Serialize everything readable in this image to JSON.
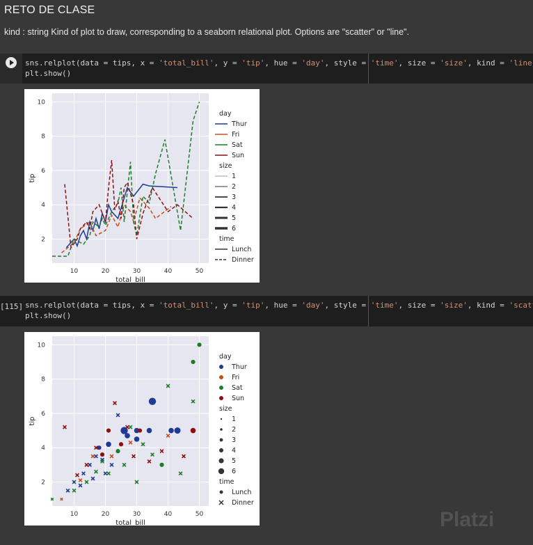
{
  "markdown": {
    "title": "RETO DE CLASE",
    "description": "kind : string Kind of plot to draw, corresponding to a seaborn relational plot. Options are \"scatter\" or \"line\"."
  },
  "cells": [
    {
      "exec_count": "",
      "code_line1_pre": "sns.relplot(data = tips, x = ",
      "code_line1_s1": "'total_bill'",
      "code_line1_m1": ", y = ",
      "code_line1_s2": "'tip'",
      "code_line1_m2": ", hue = ",
      "code_line1_s3": "'day'",
      "code_line1_m3": ", style = ",
      "code_line1_s4": "'time'",
      "code_line1_m4": ", size = ",
      "code_line1_s5": "'size'",
      "code_line1_m5": ", kind = ",
      "code_line1_s6": "'line'",
      "code_line1_end": ")",
      "code_line2": "plt.show()"
    },
    {
      "exec_count": "[115]",
      "code_line1_pre": "sns.relplot(data = tips, x = ",
      "code_line1_s1": "'total_bill'",
      "code_line1_m1": ", y = ",
      "code_line1_s2": "'tip'",
      "code_line1_m2": ", hue = ",
      "code_line1_s3": "'day'",
      "code_line1_m3": ", style = ",
      "code_line1_s4": "'time'",
      "code_line1_m4": ", size = ",
      "code_line1_s5": "'size'",
      "code_line1_m5": ", kind = ",
      "code_line1_s6": "'scatter'",
      "code_line1_end": ")",
      "code_line2": "plt.show()"
    }
  ],
  "watermark": "Platzi",
  "colors": {
    "Thur": "#1f3a93",
    "Fri": "#c0501a",
    "Sat": "#1f7a2a",
    "Sun": "#8b1010",
    "plot_bg": "#e6e6f0"
  },
  "chart_data": [
    {
      "type": "line",
      "xlabel": "total_bill",
      "ylabel": "tip",
      "xticks": [
        10,
        20,
        30,
        40,
        50
      ],
      "yticks": [
        2,
        4,
        6,
        8,
        10
      ],
      "xlim": [
        3,
        53
      ],
      "ylim": [
        0.6,
        10.5
      ],
      "legend": {
        "hue_title": "day",
        "hue": [
          "Thur",
          "Fri",
          "Sat",
          "Sun"
        ],
        "size_title": "size",
        "sizes": [
          "1",
          "2",
          "3",
          "4",
          "5",
          "6"
        ],
        "style_title": "time",
        "styles": [
          "Lunch",
          "Dinner"
        ]
      },
      "series": [
        {
          "name": "Thur",
          "style": "Lunch",
          "x": [
            7.5,
            10,
            11,
            12,
            13,
            14,
            15,
            16,
            17,
            18,
            19,
            20,
            21,
            22,
            24,
            27,
            29,
            32,
            34,
            43
          ],
          "y": [
            1.5,
            2,
            1.6,
            2.2,
            2.5,
            2,
            3,
            2.5,
            3.2,
            2.6,
            3.5,
            3,
            4,
            3.6,
            3.2,
            5,
            4.5,
            5.2,
            5.1,
            5.0
          ]
        },
        {
          "name": "Fri",
          "style": "Dinner",
          "x": [
            6,
            10,
            12,
            15,
            17,
            20,
            22,
            24,
            26,
            28,
            29,
            31,
            34,
            36,
            41
          ],
          "y": [
            1.2,
            1.8,
            2.6,
            3,
            2.2,
            2.5,
            3.4,
            2.7,
            4,
            3.6,
            3,
            4.4,
            3.8,
            3.2,
            3.9
          ]
        },
        {
          "name": "Sat",
          "style": "Dinner",
          "x": [
            3,
            8,
            10,
            13,
            15,
            16,
            18,
            19,
            20,
            22,
            24,
            25,
            26,
            28,
            29,
            30,
            32,
            34,
            36,
            39,
            44,
            48,
            50
          ],
          "y": [
            1,
            1,
            2,
            1.7,
            2.2,
            3,
            2.7,
            3.2,
            2.8,
            3.6,
            4.1,
            5,
            3,
            6.5,
            3,
            2.2,
            4.5,
            4.1,
            5.8,
            7.8,
            2.5,
            8.9,
            10
          ]
        },
        {
          "name": "Sun",
          "style": "Dinner",
          "x": [
            7,
            9,
            11,
            12,
            14,
            15,
            16,
            18,
            20,
            21,
            22,
            23,
            24,
            25,
            26,
            27,
            29,
            30,
            32,
            35,
            40,
            43,
            48
          ],
          "y": [
            5.2,
            1.5,
            2,
            2.6,
            3,
            2.6,
            3.6,
            4,
            3,
            5,
            6.6,
            3.7,
            4.2,
            3.2,
            5,
            5.3,
            4,
            2,
            3.5,
            5,
            3.6,
            4,
            3.2
          ]
        }
      ]
    },
    {
      "type": "scatter",
      "xlabel": "total_bill",
      "ylabel": "tip",
      "xticks": [
        10,
        20,
        30,
        40,
        50
      ],
      "yticks": [
        2,
        4,
        6,
        8,
        10
      ],
      "xlim": [
        3,
        53
      ],
      "ylim": [
        0.6,
        10.5
      ],
      "legend": {
        "hue_title": "day",
        "hue": [
          "Thur",
          "Fri",
          "Sat",
          "Sun"
        ],
        "size_title": "size",
        "sizes": [
          "1",
          "2",
          "3",
          "4",
          "5",
          "6"
        ],
        "style_title": "time",
        "styles": [
          "Lunch",
          "Dinner"
        ]
      },
      "points": [
        {
          "day": "Thur",
          "x": 8,
          "y": 1.5,
          "size": 2
        },
        {
          "day": "Thur",
          "x": 10,
          "y": 2,
          "size": 2
        },
        {
          "day": "Thur",
          "x": 12,
          "y": 1.8,
          "size": 2
        },
        {
          "day": "Thur",
          "x": 13,
          "y": 2.5,
          "size": 2
        },
        {
          "day": "Thur",
          "x": 15,
          "y": 3,
          "size": 2
        },
        {
          "day": "Thur",
          "x": 16,
          "y": 2.2,
          "size": 2
        },
        {
          "day": "Thur",
          "x": 17,
          "y": 3.5,
          "size": 2
        },
        {
          "day": "Thur",
          "x": 18,
          "y": 4,
          "size": 3
        },
        {
          "day": "Thur",
          "x": 19,
          "y": 3.3,
          "size": 2
        },
        {
          "day": "Thur",
          "x": 20,
          "y": 2.5,
          "size": 2
        },
        {
          "day": "Thur",
          "x": 21,
          "y": 4.2,
          "size": 4
        },
        {
          "day": "Thur",
          "x": 22,
          "y": 3,
          "size": 2
        },
        {
          "day": "Thur",
          "x": 24,
          "y": 5.9,
          "size": 2
        },
        {
          "day": "Thur",
          "x": 27,
          "y": 4.7,
          "size": 4
        },
        {
          "day": "Thur",
          "x": 30,
          "y": 4.5,
          "size": 4
        },
        {
          "day": "Thur",
          "x": 30,
          "y": 5,
          "size": 4
        },
        {
          "day": "Thur",
          "x": 35,
          "y": 6.7,
          "size": 6
        },
        {
          "day": "Thur",
          "x": 34,
          "y": 5,
          "size": 4
        },
        {
          "day": "Thur",
          "x": 41,
          "y": 5,
          "size": 4
        },
        {
          "day": "Thur",
          "x": 43,
          "y": 5,
          "size": 5
        },
        {
          "day": "Thur",
          "x": 26,
          "y": 5,
          "size": 6
        },
        {
          "day": "Fri",
          "x": 6,
          "y": 1,
          "size": 1
        },
        {
          "day": "Fri",
          "x": 12,
          "y": 2.1,
          "size": 2
        },
        {
          "day": "Fri",
          "x": 16,
          "y": 3.5,
          "size": 2
        },
        {
          "day": "Fri",
          "x": 22,
          "y": 3.5,
          "size": 2
        },
        {
          "day": "Fri",
          "x": 28,
          "y": 4.3,
          "size": 2
        },
        {
          "day": "Fri",
          "x": 40,
          "y": 4.7,
          "size": 2
        },
        {
          "day": "Sat",
          "x": 3,
          "y": 1,
          "size": 1
        },
        {
          "day": "Sat",
          "x": 10,
          "y": 1.5,
          "size": 2
        },
        {
          "day": "Sat",
          "x": 14,
          "y": 2,
          "size": 2
        },
        {
          "day": "Sat",
          "x": 17,
          "y": 2.6,
          "size": 2
        },
        {
          "day": "Sat",
          "x": 19,
          "y": 3.2,
          "size": 2
        },
        {
          "day": "Sat",
          "x": 21,
          "y": 2.5,
          "size": 2
        },
        {
          "day": "Sat",
          "x": 24,
          "y": 3.8,
          "size": 3
        },
        {
          "day": "Sat",
          "x": 26,
          "y": 3,
          "size": 2
        },
        {
          "day": "Sat",
          "x": 28,
          "y": 5.2,
          "size": 2
        },
        {
          "day": "Sat",
          "x": 30,
          "y": 2,
          "size": 2
        },
        {
          "day": "Sat",
          "x": 32,
          "y": 4.2,
          "size": 2
        },
        {
          "day": "Sat",
          "x": 35,
          "y": 3.6,
          "size": 2
        },
        {
          "day": "Sat",
          "x": 38,
          "y": 3,
          "size": 3
        },
        {
          "day": "Sat",
          "x": 40,
          "y": 7.6,
          "size": 2
        },
        {
          "day": "Sat",
          "x": 44,
          "y": 2.5,
          "size": 2
        },
        {
          "day": "Sat",
          "x": 48,
          "y": 9,
          "size": 3
        },
        {
          "day": "Sat",
          "x": 48,
          "y": 6.7,
          "size": 2
        },
        {
          "day": "Sat",
          "x": 50,
          "y": 10,
          "size": 3
        },
        {
          "day": "Sun",
          "x": 7,
          "y": 5.2,
          "size": 2
        },
        {
          "day": "Sun",
          "x": 11,
          "y": 2.4,
          "size": 2
        },
        {
          "day": "Sun",
          "x": 14,
          "y": 3,
          "size": 2
        },
        {
          "day": "Sun",
          "x": 17,
          "y": 4,
          "size": 2
        },
        {
          "day": "Sun",
          "x": 19,
          "y": 3.6,
          "size": 3
        },
        {
          "day": "Sun",
          "x": 21,
          "y": 5,
          "size": 3
        },
        {
          "day": "Sun",
          "x": 23,
          "y": 6.6,
          "size": 2
        },
        {
          "day": "Sun",
          "x": 25,
          "y": 4.2,
          "size": 3
        },
        {
          "day": "Sun",
          "x": 27,
          "y": 5.2,
          "size": 2
        },
        {
          "day": "Sun",
          "x": 29,
          "y": 3.5,
          "size": 2
        },
        {
          "day": "Sun",
          "x": 31,
          "y": 5,
          "size": 3
        },
        {
          "day": "Sun",
          "x": 34,
          "y": 3.2,
          "size": 2
        },
        {
          "day": "Sun",
          "x": 38,
          "y": 3.8,
          "size": 2
        },
        {
          "day": "Sun",
          "x": 45,
          "y": 3.5,
          "size": 2
        },
        {
          "day": "Sun",
          "x": 48,
          "y": 5,
          "size": 4
        }
      ]
    }
  ]
}
